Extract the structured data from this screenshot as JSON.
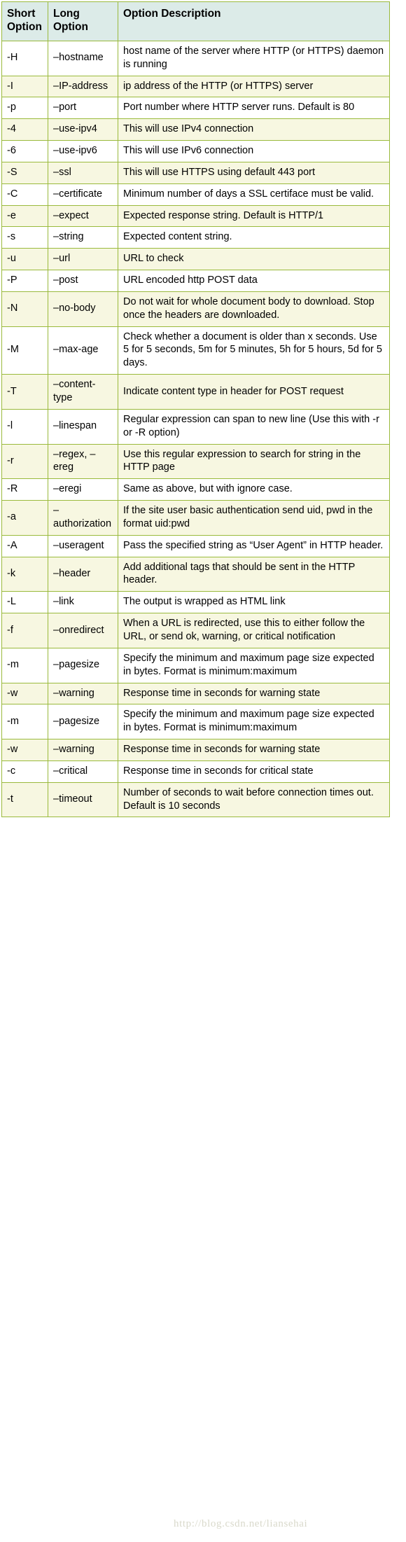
{
  "table": {
    "name": "check_http-options-table",
    "headers": [
      "Short Option",
      "Long Option",
      "Option Description"
    ],
    "rows": [
      {
        "short": "-H",
        "long": "–hostname",
        "description": "host name of the server where HTTP (or HTTPS) daemon is running"
      },
      {
        "short": "-I",
        "long": "–IP-address",
        "description": "ip address of the HTTP (or HTTPS) server"
      },
      {
        "short": "-p",
        "long": "–port",
        "description": "Port number where HTTP server runs. Default is 80"
      },
      {
        "short": "-4",
        "long": "–use-ipv4",
        "description": "This will use IPv4 connection"
      },
      {
        "short": "-6",
        "long": "–use-ipv6",
        "description": "This will use IPv6 connection"
      },
      {
        "short": "-S",
        "long": "–ssl",
        "description": "This will use HTTPS using default 443 port"
      },
      {
        "short": "-C",
        "long": "–certificate",
        "description": "Minimum number of days a SSL certiface must be valid."
      },
      {
        "short": "-e",
        "long": "–expect",
        "description": "Expected response string. Default is HTTP/1"
      },
      {
        "short": "-s",
        "long": "–string",
        "description": "Expected content string."
      },
      {
        "short": "-u",
        "long": "–url",
        "description": "URL to check"
      },
      {
        "short": "-P",
        "long": "–post",
        "description": "URL encoded http POST data"
      },
      {
        "short": "-N",
        "long": "–no-body",
        "description": "Do not wait for whole document body to download. Stop once the headers are downloaded."
      },
      {
        "short": "-M",
        "long": "–max-age",
        "description": "Check whether a document is older than x seconds. Use 5 for 5 seconds, 5m for 5 minutes, 5h for 5 hours, 5d for 5 days."
      },
      {
        "short": "-T",
        "long": "–content-type",
        "description": "Indicate content type in header for POST request"
      },
      {
        "short": "-l",
        "long": "–linespan",
        "description": "Regular expression can span to new line (Use this with -r or -R option)"
      },
      {
        "short": "-r",
        "long": "–regex, –ereg",
        "description": "Use this regular expression to search for string in the HTTP page"
      },
      {
        "short": "-R",
        "long": "–eregi",
        "description": "Same as above, but with ignore case."
      },
      {
        "short": "-a",
        "long": "– authorization",
        "description": "If the site user basic authentication send uid, pwd in the format uid:pwd"
      },
      {
        "short": "-A",
        "long": "–useragent",
        "description": "Pass the specified string as “User Agent” in HTTP header."
      },
      {
        "short": "-k",
        "long": "–header",
        "description": "Add additional tags that should be sent in the HTTP header."
      },
      {
        "short": "-L",
        "long": "–link",
        "description": "The output is wrapped as HTML link"
      },
      {
        "short": "-f",
        "long": "–onredirect",
        "description": "When a URL is redirected, use this to either follow the URL, or send ok, warning, or critical notification"
      },
      {
        "short": "-m",
        "long": "–pagesize",
        "description": "Specify the minimum and maximum page size expected in bytes. Format is minimum:maximum"
      },
      {
        "short": "-w",
        "long": "–warning",
        "description": "Response time in seconds for warning state"
      },
      {
        "short": "-m",
        "long": "–pagesize",
        "description": "Specify the minimum and maximum page size expected in bytes. Format is minimum:maximum"
      },
      {
        "short": "-w",
        "long": "–warning",
        "description": "Response time in seconds for warning state"
      },
      {
        "short": "-c",
        "long": "–critical",
        "description": "Response time in seconds for critical state"
      },
      {
        "short": "-t",
        "long": "–timeout",
        "description": "Number of seconds to wait before connection times out. Default is 10 seconds"
      }
    ]
  },
  "watermark": {
    "text": "http://blog.csdn.net/liansehai"
  },
  "colors": {
    "border": "#9aba3c",
    "header_bg": "#dcebe8",
    "row_odd_bg": "#ffffff",
    "row_even_bg": "#f7f7e1",
    "text": "#000000",
    "watermark": "#d9d9cb"
  }
}
